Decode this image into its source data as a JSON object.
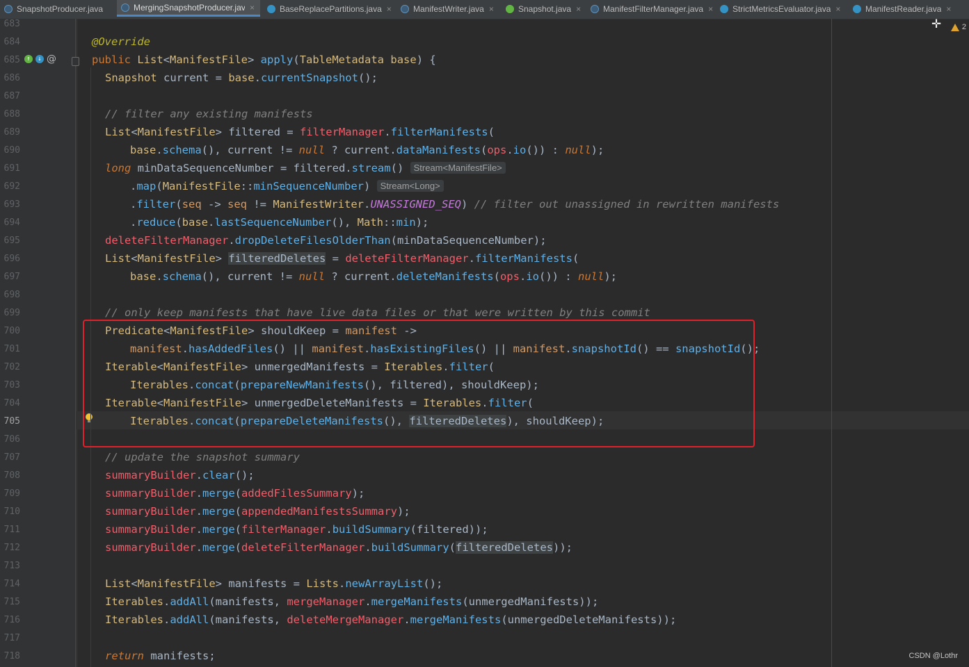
{
  "tabs": [
    {
      "label": "SnapshotProducer.java",
      "icon": "abstract-class-icon",
      "active": false
    },
    {
      "label": "MergingSnapshotProducer.java",
      "icon": "abstract-class-icon",
      "active": true
    },
    {
      "label": "BaseReplacePartitions.java",
      "icon": "class-icon",
      "active": false
    },
    {
      "label": "ManifestWriter.java",
      "icon": "abstract-class-icon",
      "active": false
    },
    {
      "label": "Snapshot.java",
      "icon": "interface-icon",
      "active": false
    },
    {
      "label": "ManifestFilterManager.java",
      "icon": "abstract-class-icon",
      "active": false
    },
    {
      "label": "StrictMetricsEvaluator.java",
      "icon": "class-icon",
      "active": false
    },
    {
      "label": "ManifestReader.java",
      "icon": "class-icon",
      "active": false
    }
  ],
  "close_glyph": "×",
  "warnings": {
    "count": "2"
  },
  "line_numbers": [
    "683",
    "684",
    "685",
    "686",
    "687",
    "688",
    "689",
    "690",
    "691",
    "692",
    "693",
    "694",
    "695",
    "696",
    "697",
    "698",
    "699",
    "700",
    "701",
    "702",
    "703",
    "704",
    "705",
    "706",
    "707",
    "708",
    "709",
    "710",
    "711",
    "712",
    "713",
    "714",
    "715",
    "716",
    "717",
    "718"
  ],
  "current_line": "705",
  "inlay_hints": {
    "stream_type": "Stream<ManifestFile>",
    "map_type": "Stream<Long>"
  },
  "code": {
    "l684": "@Override",
    "l688": "// filter any existing manifests",
    "l693_comment": "// filter out unassigned in rewritten manifests",
    "l699": "// only keep manifests that have live data files or that were written by this commit",
    "l707": "// update the snapshot summary"
  },
  "watermark": "CSDN @Lothr",
  "colors": {
    "highlight_box": "#e0202a",
    "active_tab_underline": "#4a88c7"
  }
}
